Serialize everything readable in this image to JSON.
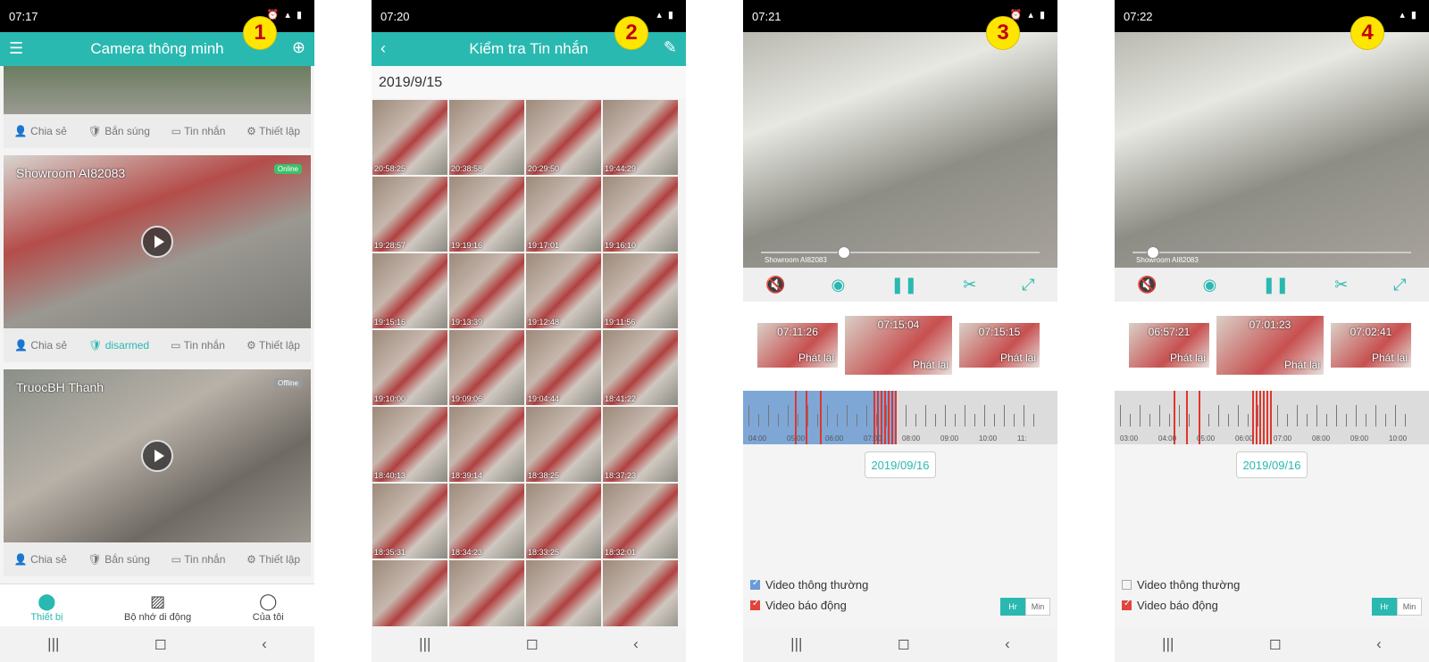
{
  "badges": [
    "1",
    "2",
    "3",
    "4"
  ],
  "screen1": {
    "status_time": "07:17",
    "title": "Camera thông minh",
    "cards": [
      {
        "name": "",
        "status": "",
        "actions": [
          "Chia sẻ",
          "Bắn súng",
          "Tin nhắn",
          "Thiết lập"
        ]
      },
      {
        "name": "Showroom AI82083",
        "status": "Online",
        "actions": [
          "Chia sẻ",
          "disarmed",
          "Tin nhắn",
          "Thiết lập"
        ]
      },
      {
        "name": "TruocBH Thanh",
        "status": "Offline",
        "actions": [
          "Chia sẻ",
          "Bắn súng",
          "Tin nhắn",
          "Thiết lập"
        ]
      }
    ],
    "tabs": [
      "Thiết bị",
      "Bộ nhớ di động",
      "Của tôi"
    ]
  },
  "screen2": {
    "status_time": "07:20",
    "title": "Kiểm tra Tin nhắn",
    "date": "2019/9/15",
    "thumbs": [
      "20:58:25",
      "20:38:58",
      "20:29:50",
      "19:44:29",
      "19:28:57",
      "19:19:16",
      "19:17:01",
      "19:16:10",
      "19:15:16",
      "19:13:39",
      "19:12:48",
      "19:11:56",
      "19:10:00",
      "19:09:06",
      "19:04:44",
      "18:41:22",
      "18:40:13",
      "18:39:14",
      "18:38:25",
      "18:37:23",
      "18:35:31",
      "18:34:23",
      "18:33:25",
      "18:32:01",
      "",
      "",
      "",
      ""
    ]
  },
  "screen3": {
    "status_time": "07:21",
    "watermark": "Showroom AI82083",
    "clips": [
      {
        "time": "07:11:26",
        "label": "Phát lại"
      },
      {
        "time": "07:15:04",
        "label": "Phát lại"
      },
      {
        "time": "07:15:15",
        "label": "Phát lại"
      }
    ],
    "timeline_labels": [
      "04:00",
      "05:00",
      "06:00",
      "07:00",
      "08:00",
      "09:00",
      "10:00",
      "11:"
    ],
    "date": "2019/09/16",
    "legend": [
      "Video thông thường",
      "Video báo động"
    ],
    "hr": "Hr",
    "min": "Min"
  },
  "screen4": {
    "status_time": "07:22",
    "watermark": "Showroom AI82083",
    "clips": [
      {
        "time": "06:57:21",
        "label": "Phát lại"
      },
      {
        "time": "07:01:23",
        "label": "Phát lại"
      },
      {
        "time": "07:02:41",
        "label": "Phát lại"
      }
    ],
    "timeline_labels": [
      "03:00",
      "04:00",
      "05:00",
      "06:00",
      "07:00",
      "08:00",
      "09:00",
      "10:00"
    ],
    "date": "2019/09/16",
    "legend": [
      "Video thông thường",
      "Video báo động"
    ],
    "hr": "Hr",
    "min": "Min"
  }
}
